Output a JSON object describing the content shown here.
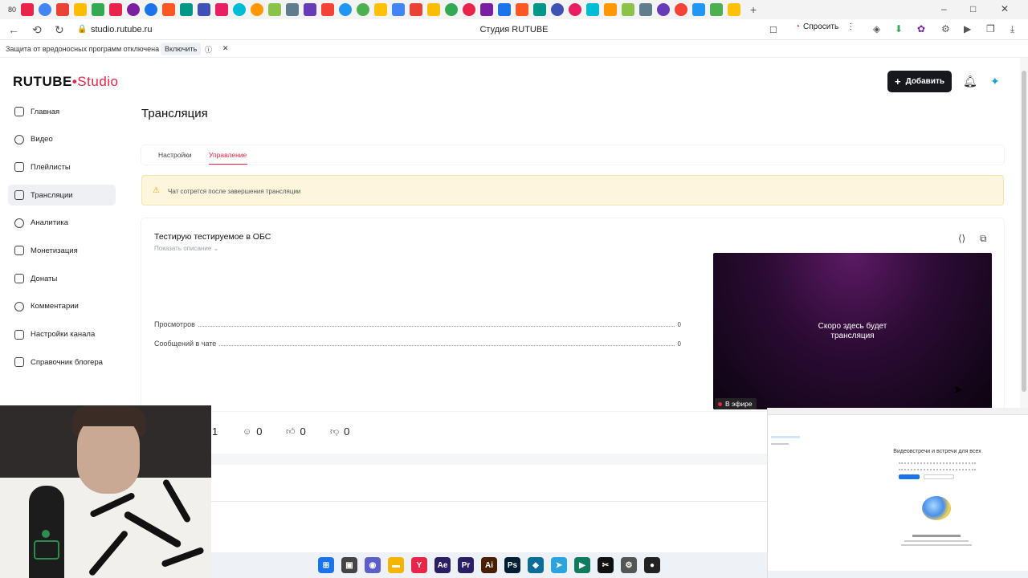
{
  "browser": {
    "tab_count": "80",
    "url": "studio.rutube.ru",
    "window_title": "Студия RUTUBE",
    "ask_label": "Спросить",
    "protection_text": "Защита от вредоносных программ отключена",
    "protection_enable": "Включить",
    "favicon_colors": [
      "#4285f4",
      "#ea4335",
      "#fbbc05",
      "#34a853",
      "#e8244a",
      "#7b1fa2",
      "#1a73e8",
      "#ff5722",
      "#009688",
      "#3f51b5",
      "#e91e63",
      "#00bcd4",
      "#ff9800",
      "#8bc34a",
      "#607d8b",
      "#673ab7",
      "#f44336",
      "#2196f3",
      "#4caf50",
      "#ffc107"
    ]
  },
  "header": {
    "logo_main": "RUTUBE",
    "logo_studio": "Studio",
    "add_label": "Добавить",
    "accent": "#e8244a"
  },
  "sidebar": {
    "items": [
      {
        "label": "Главная",
        "icon": "home-icon"
      },
      {
        "label": "Видео",
        "icon": "video-icon"
      },
      {
        "label": "Плейлисты",
        "icon": "playlist-icon"
      },
      {
        "label": "Трансляции",
        "icon": "broadcast-icon"
      },
      {
        "label": "Аналитика",
        "icon": "analytics-icon"
      },
      {
        "label": "Монетизация",
        "icon": "monetization-icon"
      },
      {
        "label": "Донаты",
        "icon": "donate-icon"
      },
      {
        "label": "Комментарии",
        "icon": "comments-icon"
      },
      {
        "label": "Настройки канала",
        "icon": "settings-icon"
      },
      {
        "label": "Справочник блогера",
        "icon": "help-icon"
      }
    ],
    "active_index": 3
  },
  "main": {
    "title": "Трансляция",
    "tabs": [
      {
        "label": "Настройки"
      },
      {
        "label": "Управление"
      }
    ],
    "warning": "Чат сотрется после завершения трансляции",
    "stream": {
      "title": "Тестирую тестируемое в ОБС",
      "show_description": "Показать описание",
      "stats": [
        {
          "label": "Просмотров",
          "value": "0"
        },
        {
          "label": "Сообщений в чате",
          "value": "0"
        }
      ],
      "player_text": "Скоро здесь будет трансляция",
      "live_label": "В эфире"
    },
    "counters": [
      {
        "icon": "viewers-icon",
        "value": "1"
      },
      {
        "icon": "person-icon",
        "value": "0"
      },
      {
        "icon": "like-icon",
        "value": "0"
      },
      {
        "icon": "dislike-icon",
        "value": "0"
      }
    ]
  },
  "mini_window": {
    "title": "Видеовстречи и встречи для всех"
  },
  "taskbar": {
    "icons": [
      {
        "name": "windows-start-icon",
        "glyph": "⊞",
        "color": "#1a73e8"
      },
      {
        "name": "task-view-icon",
        "glyph": "▣",
        "color": "#444"
      },
      {
        "name": "chat-icon",
        "glyph": "◉",
        "color": "#5b5fc7"
      },
      {
        "name": "explorer-icon",
        "glyph": "▬",
        "color": "#f4b400"
      },
      {
        "name": "yandex-browser-icon",
        "glyph": "Y",
        "color": "#e8244a"
      },
      {
        "name": "after-effects-icon",
        "glyph": "Ae",
        "color": "#2b1e66"
      },
      {
        "name": "premiere-icon",
        "glyph": "Pr",
        "color": "#2b1e66"
      },
      {
        "name": "illustrator-icon",
        "glyph": "Ai",
        "color": "#4a1f00"
      },
      {
        "name": "photoshop-icon",
        "glyph": "Ps",
        "color": "#001e36"
      },
      {
        "name": "app-icon",
        "glyph": "◆",
        "color": "#0b6e99"
      },
      {
        "name": "telegram-icon",
        "glyph": "➤",
        "color": "#2aa3de"
      },
      {
        "name": "green-app-icon",
        "glyph": "▶",
        "color": "#0f7b5f"
      },
      {
        "name": "capcut-icon",
        "glyph": "✂",
        "color": "#111"
      },
      {
        "name": "gear-icon",
        "glyph": "⚙",
        "color": "#555"
      },
      {
        "name": "obs-icon",
        "glyph": "●",
        "color": "#222"
      }
    ]
  }
}
